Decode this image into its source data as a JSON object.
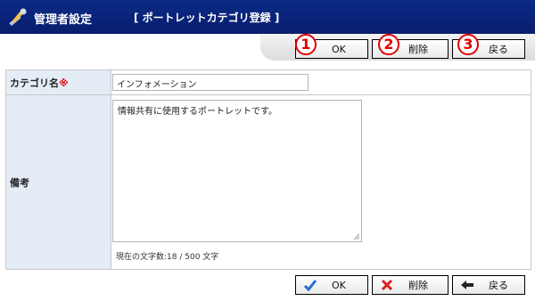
{
  "header": {
    "title": "管理者設定",
    "subtitle": "[ ポートレットカテゴリ登録 ]",
    "icon": "tools-icon"
  },
  "toolbar": {
    "ok": "OK",
    "delete": "削除",
    "back": "戻る"
  },
  "callouts": [
    "1",
    "2",
    "3"
  ],
  "form": {
    "category_label": "カテゴリ名",
    "required_mark": "※",
    "category_value": "インフォメーション",
    "note_label": "備考",
    "note_value": "情報共有に使用するポートレットです。",
    "counter": "現在の文字数:18 / 500 文字"
  },
  "colors": {
    "header_bg": "#0b2a86",
    "label_bg": "#e4ecf6",
    "callout": "#e00000"
  }
}
